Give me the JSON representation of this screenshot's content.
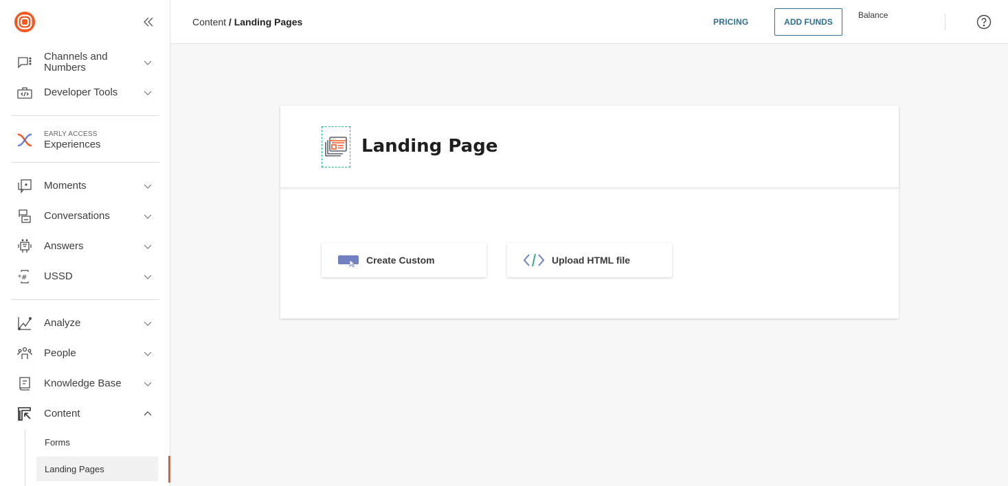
{
  "sidebar": {
    "collapse_icon": "double-chevron-left-icon",
    "items_group1": [
      {
        "label": "Channels and Numbers",
        "icon": "chat-dots-icon",
        "expanded": false
      },
      {
        "label": "Developer Tools",
        "icon": "code-briefcase-icon",
        "expanded": false
      }
    ],
    "early_access": {
      "tag": "EARLY ACCESS",
      "label": "Experiences",
      "icon": "experiences-x-icon"
    },
    "items_group2": [
      {
        "label": "Moments",
        "icon": "moments-icon",
        "expanded": false
      },
      {
        "label": "Conversations",
        "icon": "conversations-icon",
        "expanded": false
      },
      {
        "label": "Answers",
        "icon": "bot-icon",
        "expanded": false
      },
      {
        "label": "USSD",
        "icon": "ussd-icon",
        "expanded": false
      }
    ],
    "items_group3": [
      {
        "label": "Analyze",
        "icon": "chart-line-icon",
        "expanded": false
      },
      {
        "label": "People",
        "icon": "people-icon",
        "expanded": false
      },
      {
        "label": "Knowledge Base",
        "icon": "book-icon",
        "expanded": false
      },
      {
        "label": "Content",
        "icon": "content-icon",
        "expanded": true
      }
    ],
    "content_sub": [
      {
        "label": "Forms",
        "active": false
      },
      {
        "label": "Landing Pages",
        "active": true
      }
    ]
  },
  "header": {
    "breadcrumb": {
      "parent": "Content",
      "separator": " / ",
      "current": "Landing Pages"
    },
    "pricing_label": "PRICING",
    "add_funds_label": "ADD FUNDS",
    "balance_label": "Balance",
    "help_icon": "help-circle-icon"
  },
  "card": {
    "title": "Landing Page",
    "options": [
      {
        "label": "Create Custom",
        "icon": "cursor-button-icon"
      },
      {
        "label": "Upload HTML file",
        "icon": "code-icon"
      }
    ]
  },
  "colors": {
    "brand": "#f4561d",
    "link": "#2f6f8f",
    "accent_green": "#2bb08a",
    "accent_purple": "#7080c0"
  }
}
